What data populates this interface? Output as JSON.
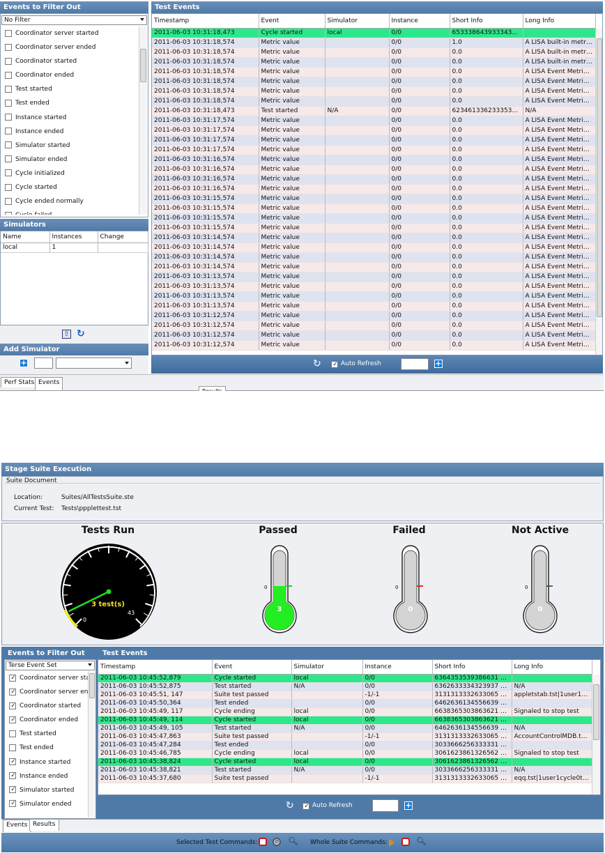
{
  "top": {
    "filter_panel": {
      "title": "Events to Filter Out",
      "filter_value": "No Filter",
      "items": [
        {
          "label": "Coordinator server started",
          "checked": false
        },
        {
          "label": "Coordinator server ended",
          "checked": false
        },
        {
          "label": "Coordinator started",
          "checked": false
        },
        {
          "label": "Coordinator ended",
          "checked": false
        },
        {
          "label": "Test started",
          "checked": false
        },
        {
          "label": "Test ended",
          "checked": false
        },
        {
          "label": "Instance started",
          "checked": false
        },
        {
          "label": "Instance ended",
          "checked": false
        },
        {
          "label": "Simulator started",
          "checked": false
        },
        {
          "label": "Simulator ended",
          "checked": false
        },
        {
          "label": "Cycle initialized",
          "checked": false
        },
        {
          "label": "Cycle started",
          "checked": false
        },
        {
          "label": "Cycle ended normally",
          "checked": false
        },
        {
          "label": "Cycle failed",
          "checked": false
        }
      ]
    },
    "simulators": {
      "title": "Simulators",
      "headers": [
        "Name",
        "Instances",
        "Change"
      ],
      "rows": [
        [
          "local",
          "1",
          ""
        ]
      ]
    },
    "add_simulator": {
      "title": "Add Simulator",
      "count_value": "",
      "select_value": ""
    },
    "tabs": [
      "Perf Stats",
      "Events"
    ],
    "hidden_tab": "Results",
    "events": {
      "title": "Test Events",
      "headers": [
        "Timestamp",
        "Event",
        "Simulator",
        "Instance",
        "Short Info",
        "Long Info"
      ],
      "rows": [
        {
          "c": [
            "2011-06-03 10:31:18,473",
            "Cycle started",
            "local",
            "0/0",
            "6533386439333436220...",
            ""
          ],
          "s": "g"
        },
        {
          "c": [
            "2011-06-03 10:31:18,574",
            "Metric value",
            "",
            "0/0",
            "1.0",
            "A LISA built-in metric: ..."
          ],
          "s": "b"
        },
        {
          "c": [
            "2011-06-03 10:31:18,574",
            "Metric value",
            "",
            "0/0",
            "0.0",
            "A LISA built-in metric: ..."
          ],
          "s": "a"
        },
        {
          "c": [
            "2011-06-03 10:31:18,574",
            "Metric value",
            "",
            "0/0",
            "0.0",
            "A LISA built-in metric: ..."
          ],
          "s": "b"
        },
        {
          "c": [
            "2011-06-03 10:31:18,574",
            "Metric value",
            "",
            "0/0",
            "0.0",
            "A LISA Event Metric: ..."
          ],
          "s": "a"
        },
        {
          "c": [
            "2011-06-03 10:31:18,574",
            "Metric value",
            "",
            "0/0",
            "0.0",
            "A LISA Event Metric: ..."
          ],
          "s": "b"
        },
        {
          "c": [
            "2011-06-03 10:31:18,574",
            "Metric value",
            "",
            "0/0",
            "0.0",
            "A LISA Event Metric: ..."
          ],
          "s": "a"
        },
        {
          "c": [
            "2011-06-03 10:31:18,574",
            "Metric value",
            "",
            "0/0",
            "0.0",
            "A LISA Event Metric: ..."
          ],
          "s": "b"
        },
        {
          "c": [
            "2011-06-03 10:31:18,473",
            "Test started",
            "N/A",
            "0/0",
            "6234613362333531229...",
            "N/A"
          ],
          "s": "a"
        },
        {
          "c": [
            "2011-06-03 10:31:17,574",
            "Metric value",
            "",
            "0/0",
            "0.0",
            "A LISA Event Metric: ..."
          ],
          "s": "b"
        },
        {
          "c": [
            "2011-06-03 10:31:17,574",
            "Metric value",
            "",
            "0/0",
            "0.0",
            "A LISA Event Metric: ..."
          ],
          "s": "a"
        },
        {
          "c": [
            "2011-06-03 10:31:17,574",
            "Metric value",
            "",
            "0/0",
            "0.0",
            "A LISA Event Metric: ..."
          ],
          "s": "b"
        },
        {
          "c": [
            "2011-06-03 10:31:17,574",
            "Metric value",
            "",
            "0/0",
            "0.0",
            "A LISA Event Metric: ..."
          ],
          "s": "a"
        },
        {
          "c": [
            "2011-06-03 10:31:16,574",
            "Metric value",
            "",
            "0/0",
            "0.0",
            "A LISA Event Metric: ..."
          ],
          "s": "b"
        },
        {
          "c": [
            "2011-06-03 10:31:16,574",
            "Metric value",
            "",
            "0/0",
            "0.0",
            "A LISA Event Metric: ..."
          ],
          "s": "a"
        },
        {
          "c": [
            "2011-06-03 10:31:16,574",
            "Metric value",
            "",
            "0/0",
            "0.0",
            "A LISA Event Metric: ..."
          ],
          "s": "b"
        },
        {
          "c": [
            "2011-06-03 10:31:16,574",
            "Metric value",
            "",
            "0/0",
            "0.0",
            "A LISA Event Metric: ..."
          ],
          "s": "a"
        },
        {
          "c": [
            "2011-06-03 10:31:15,574",
            "Metric value",
            "",
            "0/0",
            "0.0",
            "A LISA Event Metric: ..."
          ],
          "s": "b"
        },
        {
          "c": [
            "2011-06-03 10:31:15,574",
            "Metric value",
            "",
            "0/0",
            "0.0",
            "A LISA Event Metric: ..."
          ],
          "s": "a"
        },
        {
          "c": [
            "2011-06-03 10:31:15,574",
            "Metric value",
            "",
            "0/0",
            "0.0",
            "A LISA Event Metric: ..."
          ],
          "s": "b"
        },
        {
          "c": [
            "2011-06-03 10:31:15,574",
            "Metric value",
            "",
            "0/0",
            "0.0",
            "A LISA Event Metric: ..."
          ],
          "s": "a"
        },
        {
          "c": [
            "2011-06-03 10:31:14,574",
            "Metric value",
            "",
            "0/0",
            "0.0",
            "A LISA Event Metric: ..."
          ],
          "s": "b"
        },
        {
          "c": [
            "2011-06-03 10:31:14,574",
            "Metric value",
            "",
            "0/0",
            "0.0",
            "A LISA Event Metric: ..."
          ],
          "s": "a"
        },
        {
          "c": [
            "2011-06-03 10:31:14,574",
            "Metric value",
            "",
            "0/0",
            "0.0",
            "A LISA Event Metric: ..."
          ],
          "s": "b"
        },
        {
          "c": [
            "2011-06-03 10:31:14,574",
            "Metric value",
            "",
            "0/0",
            "0.0",
            "A LISA Event Metric: ..."
          ],
          "s": "a"
        },
        {
          "c": [
            "2011-06-03 10:31:13,574",
            "Metric value",
            "",
            "0/0",
            "0.0",
            "A LISA Event Metric: ..."
          ],
          "s": "b"
        },
        {
          "c": [
            "2011-06-03 10:31:13,574",
            "Metric value",
            "",
            "0/0",
            "0.0",
            "A LISA Event Metric: ..."
          ],
          "s": "a"
        },
        {
          "c": [
            "2011-06-03 10:31:13,574",
            "Metric value",
            "",
            "0/0",
            "0.0",
            "A LISA Event Metric: ..."
          ],
          "s": "b"
        },
        {
          "c": [
            "2011-06-03 10:31:13,574",
            "Metric value",
            "",
            "0/0",
            "0.0",
            "A LISA Event Metric: ..."
          ],
          "s": "a"
        },
        {
          "c": [
            "2011-06-03 10:31:12,574",
            "Metric value",
            "",
            "0/0",
            "0.0",
            "A LISA Event Metric: ..."
          ],
          "s": "b"
        },
        {
          "c": [
            "2011-06-03 10:31:12,574",
            "Metric value",
            "",
            "0/0",
            "0.0",
            "A LISA Event Metric: ..."
          ],
          "s": "a"
        },
        {
          "c": [
            "2011-06-03 10:31:12,574",
            "Metric value",
            "",
            "0/0",
            "0.0",
            "A LISA Event Metric: ..."
          ],
          "s": "b"
        },
        {
          "c": [
            "2011-06-03 10:31:12,574",
            "Metric value",
            "",
            "0/0",
            "0.0",
            "A LISA Event Metric: ..."
          ],
          "s": "a"
        }
      ],
      "auto_refresh_label": "Auto Refresh",
      "auto_refresh_checked": true,
      "refresh_value": ""
    }
  },
  "bottom": {
    "title": "Stage Suite Execution",
    "suite_doc": {
      "section_title": "Suite Document",
      "location_label": "Location:",
      "location_value": "Suites/AllTestsSuite.ste",
      "current_label": "Current Test:",
      "current_value": "Tests\\ppplettest.tst"
    },
    "gauges": {
      "tests_run": {
        "title": "Tests Run",
        "label": "3 test(s)",
        "min": "0",
        "max": "43",
        "value": 3
      },
      "passed": {
        "title": "Passed",
        "value": "3",
        "scale_zero": "0",
        "fill_fraction": 0.6,
        "color": "#22ee22"
      },
      "failed": {
        "title": "Failed",
        "value": "0",
        "scale_zero": "0",
        "color": "#ee2222"
      },
      "not_active": {
        "title": "Not Active",
        "value": "0",
        "scale_zero": "0"
      }
    },
    "filter_panel": {
      "title": "Events to Filter Out",
      "filter_value": "Terse Event Set",
      "items": [
        {
          "label": "Coordinator server started",
          "checked": true
        },
        {
          "label": "Coordinator server ended",
          "checked": true
        },
        {
          "label": "Coordinator started",
          "checked": true
        },
        {
          "label": "Coordinator ended",
          "checked": true
        },
        {
          "label": "Test started",
          "checked": false
        },
        {
          "label": "Test ended",
          "checked": false
        },
        {
          "label": "Instance started",
          "checked": true
        },
        {
          "label": "Instance ended",
          "checked": true
        },
        {
          "label": "Simulator started",
          "checked": true
        },
        {
          "label": "Simulator ended",
          "checked": true
        }
      ]
    },
    "events": {
      "title": "Test Events",
      "headers": [
        "Timestamp",
        "Event",
        "Simulator",
        "Instance",
        "Short Info",
        "Long Info"
      ],
      "rows": [
        {
          "c": [
            "2011-06-03 10:45:52,879",
            "Cycle started",
            "local",
            "0/0",
            "6364353539386631 2D3...",
            ""
          ],
          "s": "g"
        },
        {
          "c": [
            "2011-06-03 10:45:52,875",
            "Test started",
            "N/A",
            "0/0",
            "6362633334323937 2D...",
            "N/A"
          ],
          "s": "b"
        },
        {
          "c": [
            "2011-06-03 10:45:51, 147",
            "Suite test passed",
            "",
            "-1/-1",
            "3131313332633065 2D6...",
            "appletstab.tst|1user1cy..."
          ],
          "s": "a"
        },
        {
          "c": [
            "2011-06-03 10:45:50,364",
            "Test ended",
            "",
            "0/0",
            "6462636134556639 2D6...",
            ""
          ],
          "s": "b"
        },
        {
          "c": [
            "2011-06-03 10:45:49, 117",
            "Cycle ending",
            "local",
            "0/0",
            "6638365303863621 2D6...",
            "Signaled to stop test"
          ],
          "s": "a"
        },
        {
          "c": [
            "2011-06-03 10:45:49, 114",
            "Cycle started",
            "local",
            "0/0",
            "6638365303863621 2D6...",
            ""
          ],
          "s": "g"
        },
        {
          "c": [
            "2011-06-03 10:45:49, 105",
            "Test started",
            "N/A",
            "0/0",
            "6462636134556639 2D6...",
            "N/A"
          ],
          "s": "b"
        },
        {
          "c": [
            "2011-06-03 10:45:47,863",
            "Suite test passed",
            "",
            "-1/-1",
            "3131313332633065 2D6...",
            "AccountControlMDB.tst|..."
          ],
          "s": "a"
        },
        {
          "c": [
            "2011-06-03 10:45:47,284",
            "Test ended",
            "",
            "0/0",
            "3033666256333331 2D2...",
            ""
          ],
          "s": "b"
        },
        {
          "c": [
            "2011-06-03 10:45:46,785",
            "Cycle ending",
            "local",
            "0/0",
            "3061623861326562 2D3...",
            "Signaled to stop test"
          ],
          "s": "a"
        },
        {
          "c": [
            "2011-06-03 10:45:38,824",
            "Cycle started",
            "local",
            "0/0",
            "3061623861326562 2D3...",
            ""
          ],
          "s": "g"
        },
        {
          "c": [
            "2011-06-03 10:45:38,821",
            "Test started",
            "N/A",
            "0/0",
            "3033666256333331 2D2...",
            "N/A"
          ],
          "s": "b"
        },
        {
          "c": [
            "2011-06-03 10:45:37,680",
            "Suite test passed",
            "",
            "-1/-1",
            "3131313332633065 2D6...",
            "eqq.tst|1user1cycle0thi..."
          ],
          "s": "a"
        }
      ],
      "auto_refresh_label": "Auto Refresh",
      "auto_refresh_checked": true,
      "refresh_value": ""
    },
    "tabs": [
      "Events",
      "Results"
    ],
    "commands": {
      "selected_label": "Selected Test Commands:",
      "whole_label": "Whole Suite Commands:"
    }
  }
}
